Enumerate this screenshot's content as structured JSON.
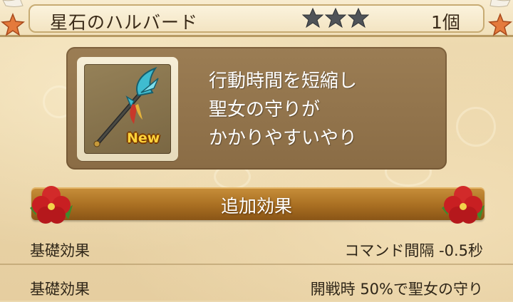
{
  "header": {
    "item_name": "星石のハルバード",
    "stars": 3,
    "count": "1個"
  },
  "item": {
    "badge": "New",
    "icon": "halberd-icon",
    "description": [
      "行動時間を短縮し",
      "聖女の守りが",
      "かかりやすいやり"
    ]
  },
  "section": {
    "title": "追加効果"
  },
  "effects": [
    {
      "label": "基礎効果",
      "value": "コマンド間隔 -0.5秒"
    },
    {
      "label": "基礎効果",
      "value": "開戦時 50%で聖女の守り"
    }
  ],
  "colors": {
    "star": "#4f5358",
    "banner": "#a96f22",
    "badge": "#ffd23a",
    "panel": "#8f7149"
  }
}
